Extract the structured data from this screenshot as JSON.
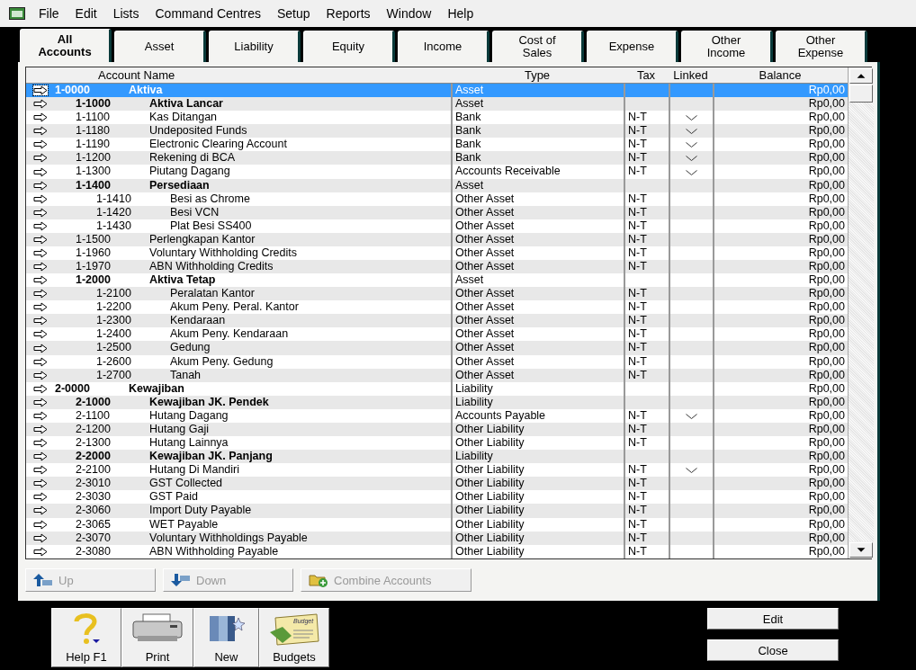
{
  "menu": [
    "File",
    "Edit",
    "Lists",
    "Command Centres",
    "Setup",
    "Reports",
    "Window",
    "Help"
  ],
  "tabs": [
    {
      "label": "All Accounts",
      "selected": true
    },
    {
      "label": "Asset",
      "selected": false
    },
    {
      "label": "Liability",
      "selected": false
    },
    {
      "label": "Equity",
      "selected": false
    },
    {
      "label": "Income",
      "selected": false
    },
    {
      "label": "Cost of Sales",
      "selected": false
    },
    {
      "label": "Expense",
      "selected": false
    },
    {
      "label": "Other Income",
      "selected": false
    },
    {
      "label": "Other Expense",
      "selected": false
    }
  ],
  "table": {
    "columns": [
      "Account Name",
      "Type",
      "Tax",
      "Linked",
      "Balance"
    ],
    "rows": [
      {
        "number": "1-0000",
        "name": "Aktiva",
        "type": "Asset",
        "balance": "Rp0,00",
        "header": true,
        "linked": false,
        "selected": true,
        "children": [
          {
            "number": "1-1000",
            "name": "Aktiva Lancar",
            "type": "Asset",
            "balance": "Rp0,00",
            "header": true,
            "linked": false,
            "selected": false
          },
          {
            "number": "1-1100",
            "name": "Kas Ditangan",
            "type": "Bank",
            "tax": "N-T",
            "balance": "Rp0,00",
            "header": false,
            "linked": true,
            "selected": false
          },
          {
            "number": "1-1180",
            "name": "Undeposited Funds",
            "type": "Bank",
            "tax": "N-T",
            "balance": "Rp0,00",
            "header": false,
            "linked": true,
            "selected": false
          },
          {
            "number": "1-1190",
            "name": "Electronic Clearing Account",
            "type": "Bank",
            "tax": "N-T",
            "balance": "Rp0,00",
            "header": false,
            "linked": true,
            "selected": false
          },
          {
            "number": "1-1200",
            "name": "Rekening di BCA",
            "type": "Bank",
            "tax": "N-T",
            "balance": "Rp0,00",
            "header": false,
            "linked": true,
            "selected": false
          },
          {
            "number": "1-1300",
            "name": "Piutang Dagang",
            "type": "Accounts Receivable",
            "tax": "N-T",
            "balance": "Rp0,00",
            "header": false,
            "linked": true,
            "selected": false
          },
          {
            "number": "1-1400",
            "name": "Persediaan",
            "type": "Asset",
            "balance": "Rp0,00",
            "header": true,
            "linked": false,
            "selected": false,
            "children": [
              {
                "number": "1-1410",
                "name": "Besi as Chrome",
                "type": "Other Asset",
                "tax": "N-T",
                "balance": "Rp0,00",
                "header": false,
                "linked": false,
                "selected": false
              },
              {
                "number": "1-1420",
                "name": "Besi VCN",
                "type": "Other Asset",
                "tax": "N-T",
                "balance": "Rp0,00",
                "header": false,
                "linked": false,
                "selected": false
              },
              {
                "number": "1-1430",
                "name": "Plat Besi SS400",
                "type": "Other Asset",
                "tax": "N-T",
                "balance": "Rp0,00",
                "header": false,
                "linked": false,
                "selected": false
              }
            ]
          },
          {
            "number": "1-1500",
            "name": "Perlengkapan Kantor",
            "type": "Other Asset",
            "tax": "N-T",
            "balance": "Rp0,00",
            "header": false,
            "linked": false,
            "selected": false
          },
          {
            "number": "1-1960",
            "name": "Voluntary Withholding Credits",
            "type": "Other Asset",
            "tax": "N-T",
            "balance": "Rp0,00",
            "header": false,
            "linked": false,
            "selected": false
          },
          {
            "number": "1-1970",
            "name": "ABN Withholding Credits",
            "type": "Other Asset",
            "tax": "N-T",
            "balance": "Rp0,00",
            "header": false,
            "linked": false,
            "selected": false
          },
          {
            "number": "1-2000",
            "name": "Aktiva Tetap",
            "type": "Asset",
            "balance": "Rp0,00",
            "header": true,
            "linked": false,
            "selected": false,
            "children": [
              {
                "number": "1-2100",
                "name": "Peralatan Kantor",
                "type": "Other Asset",
                "tax": "N-T",
                "balance": "Rp0,00",
                "header": false,
                "linked": false,
                "selected": false
              },
              {
                "number": "1-2200",
                "name": "Akum Peny. Peral. Kantor",
                "type": "Other Asset",
                "tax": "N-T",
                "balance": "Rp0,00",
                "header": false,
                "linked": false,
                "selected": false
              },
              {
                "number": "1-2300",
                "name": "Kendaraan",
                "type": "Other Asset",
                "tax": "N-T",
                "balance": "Rp0,00",
                "header": false,
                "linked": false,
                "selected": false
              },
              {
                "number": "1-2400",
                "name": "Akum Peny. Kendaraan",
                "type": "Other Asset",
                "tax": "N-T",
                "balance": "Rp0,00",
                "header": false,
                "linked": false,
                "selected": false
              },
              {
                "number": "1-2500",
                "name": "Gedung",
                "type": "Other Asset",
                "tax": "N-T",
                "balance": "Rp0,00",
                "header": false,
                "linked": false,
                "selected": false
              },
              {
                "number": "1-2600",
                "name": "Akum Peny. Gedung",
                "type": "Other Asset",
                "tax": "N-T",
                "balance": "Rp0,00",
                "header": false,
                "linked": false,
                "selected": false
              },
              {
                "number": "1-2700",
                "name": "Tanah",
                "type": "Other Asset",
                "tax": "N-T",
                "balance": "Rp0,00",
                "header": false,
                "linked": false,
                "selected": false
              }
            ]
          }
        ]
      },
      {
        "number": "2-0000",
        "name": "Kewajiban",
        "type": "Liability",
        "balance": "Rp0,00",
        "header": true,
        "linked": false,
        "selected": false,
        "children": [
          {
            "number": "2-1000",
            "name": "Kewajiban JK. Pendek",
            "type": "Liability",
            "balance": "Rp0,00",
            "header": true,
            "linked": false,
            "selected": false
          },
          {
            "number": "2-1100",
            "name": "Hutang Dagang",
            "type": "Accounts Payable",
            "tax": "N-T",
            "balance": "Rp0,00",
            "header": false,
            "linked": true,
            "selected": false
          },
          {
            "number": "2-1200",
            "name": "Hutang Gaji",
            "type": "Other Liability",
            "tax": "N-T",
            "balance": "Rp0,00",
            "header": false,
            "linked": false,
            "selected": false
          },
          {
            "number": "2-1300",
            "name": "Hutang Lainnya",
            "type": "Other Liability",
            "tax": "N-T",
            "balance": "Rp0,00",
            "header": false,
            "linked": false,
            "selected": false
          },
          {
            "number": "2-2000",
            "name": "Kewajiban JK. Panjang",
            "type": "Liability",
            "balance": "Rp0,00",
            "header": true,
            "linked": false,
            "selected": false
          },
          {
            "number": "2-2100",
            "name": "Hutang Di Mandiri",
            "type": "Other Liability",
            "tax": "N-T",
            "balance": "Rp0,00",
            "header": false,
            "linked": true,
            "selected": false
          },
          {
            "number": "2-3010",
            "name": "GST Collected",
            "type": "Other Liability",
            "tax": "N-T",
            "balance": "Rp0,00",
            "header": false,
            "linked": false,
            "selected": false
          },
          {
            "number": "2-3030",
            "name": "GST Paid",
            "type": "Other Liability",
            "tax": "N-T",
            "balance": "Rp0,00",
            "header": false,
            "linked": false,
            "selected": false
          },
          {
            "number": "2-3060",
            "name": "Import Duty Payable",
            "type": "Other Liability",
            "tax": "N-T",
            "balance": "Rp0,00",
            "header": false,
            "linked": false,
            "selected": false
          },
          {
            "number": "2-3065",
            "name": "WET Payable",
            "type": "Other Liability",
            "tax": "N-T",
            "balance": "Rp0,00",
            "header": false,
            "linked": false,
            "selected": false
          },
          {
            "number": "2-3070",
            "name": "Voluntary Withholdings Payable",
            "type": "Other Liability",
            "tax": "N-T",
            "balance": "Rp0,00",
            "header": false,
            "linked": false,
            "selected": false
          },
          {
            "number": "2-3080",
            "name": "ABN Withholding Payable",
            "type": "Other Liability",
            "tax": "N-T",
            "balance": "Rp0,00",
            "header": false,
            "linked": false,
            "selected": false
          }
        ]
      }
    ]
  },
  "list_buttons": [
    {
      "kind": "up",
      "label": "Up",
      "disabled": true
    },
    {
      "kind": "down",
      "label": "Down",
      "disabled": true
    },
    {
      "kind": "combine",
      "label": "Combine Accounts",
      "disabled": true
    }
  ],
  "toolbar": [
    {
      "kind": "help",
      "label": "Help F1"
    },
    {
      "kind": "print",
      "label": "Print"
    },
    {
      "kind": "new",
      "label": "New"
    },
    {
      "kind": "budgets",
      "label": "Budgets",
      "badge": "Budget"
    }
  ],
  "actions": [
    "Edit",
    "Close"
  ]
}
